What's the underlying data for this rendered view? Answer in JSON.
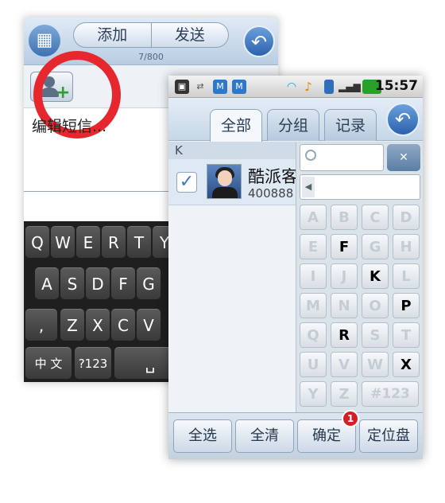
{
  "compose": {
    "add_label": "添加",
    "send_label": "发送",
    "char_count": "7/800",
    "placeholder_text": "编辑短信..."
  },
  "keyboard": {
    "row1": [
      "Q",
      "W",
      "E",
      "R",
      "T",
      "Y"
    ],
    "row2": [
      "A",
      "S",
      "D",
      "F",
      "G"
    ],
    "row3": [
      ",",
      "Z",
      "X",
      "C",
      "V"
    ],
    "lang_key": "中 文",
    "sym_key": "?123",
    "space_key": "␣"
  },
  "status_bar": {
    "time": "15:57"
  },
  "picker": {
    "tabs": [
      "全部",
      "分组",
      "记录"
    ],
    "active_tab": "全部",
    "section_letter": "K",
    "contact": {
      "name": "酷派客",
      "number": "400888",
      "checked": true
    }
  },
  "keypad": {
    "keys": [
      [
        "A",
        "B",
        "C",
        "D"
      ],
      [
        "E",
        "F",
        "G",
        "H"
      ],
      [
        "I",
        "J",
        "K",
        "L"
      ],
      [
        "M",
        "N",
        "O",
        "P"
      ],
      [
        "Q",
        "R",
        "S",
        "T"
      ],
      [
        "U",
        "V",
        "W",
        "X"
      ],
      [
        "Y",
        "Z",
        "#123"
      ]
    ],
    "active_keys": [
      "F",
      "K",
      "P",
      "R",
      "X"
    ]
  },
  "bottom_bar": {
    "select_all": "全选",
    "clear_all": "全清",
    "confirm": "确定",
    "locate": "定位盘",
    "confirm_badge": "1"
  },
  "colors": {
    "highlight_ring": "#e6282e",
    "badge": "#d32026",
    "accent_blue": "#2b62ad"
  }
}
